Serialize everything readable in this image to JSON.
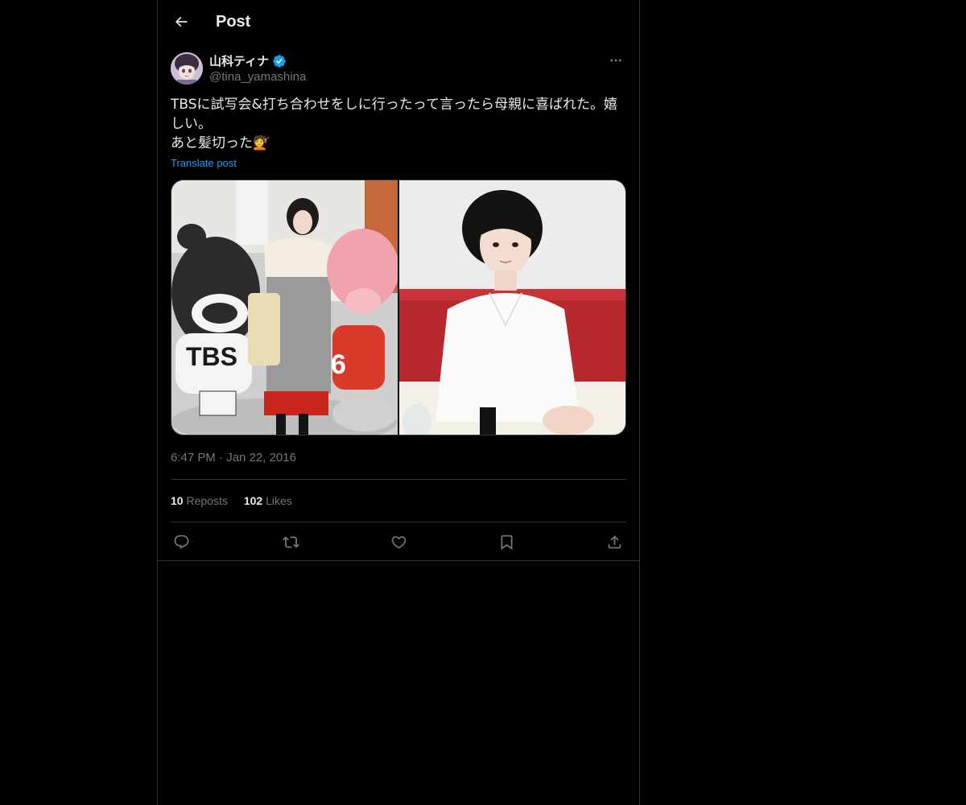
{
  "header": {
    "back_icon": "arrow-left-icon",
    "title": "Post"
  },
  "author": {
    "display_name": "山科ティナ",
    "handle": "@tina_yamashina",
    "verified": true,
    "avatar_icon": "avatar"
  },
  "post": {
    "text": "TBSに試写会&打ち合わせをしに行ったって言ったら母親に喜ばれた。嬉しい。\nあと髪切った💇",
    "translate_label": "Translate post",
    "timestamp": "6:47 PM",
    "separator": "·",
    "date": "Jan 22, 2016"
  },
  "stats": {
    "reposts_count": "10",
    "reposts_label": "Reposts",
    "likes_count": "102",
    "likes_label": "Likes"
  },
  "actions": [
    {
      "icon": "reply-icon"
    },
    {
      "icon": "repost-icon"
    },
    {
      "icon": "like-icon"
    },
    {
      "icon": "bookmark-icon"
    },
    {
      "icon": "share-icon"
    }
  ],
  "colors": {
    "background": "#000000",
    "text_primary": "#e7e9ea",
    "text_secondary": "#71767b",
    "accent": "#1d9bf0",
    "border": "#2f3336"
  }
}
